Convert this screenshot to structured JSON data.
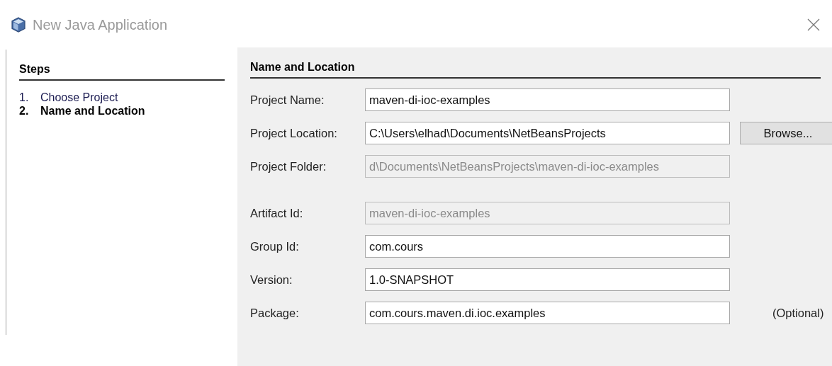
{
  "window": {
    "title": "New Java Application"
  },
  "steps": {
    "title": "Steps",
    "items": [
      {
        "number": "1.",
        "label": "Choose Project",
        "selected": false
      },
      {
        "number": "2.",
        "label": "Name and Location",
        "selected": true
      }
    ]
  },
  "panel": {
    "title": "Name and Location",
    "sections": [
      {
        "fields": [
          {
            "label": "Project Name:",
            "value": "maven-di-ioc-examples",
            "disabled": false
          },
          {
            "label": "Project Location:",
            "value": "C:\\Users\\elhad\\Documents\\NetBeansProjects",
            "disabled": false,
            "button": "Browse..."
          },
          {
            "label": "Project Folder:",
            "value": "d\\Documents\\NetBeansProjects\\maven-di-ioc-examples",
            "disabled": true
          }
        ]
      },
      {
        "fields": [
          {
            "label": "Artifact Id:",
            "value": "maven-di-ioc-examples",
            "disabled": true
          },
          {
            "label": "Group Id:",
            "value": "com.cours",
            "disabled": false
          },
          {
            "label": "Version:",
            "value": "1.0-SNAPSHOT",
            "disabled": false
          },
          {
            "label": "Package:",
            "value": "com.cours.maven.di.ioc.examples",
            "disabled": false,
            "note": "(Optional)"
          }
        ]
      }
    ]
  }
}
